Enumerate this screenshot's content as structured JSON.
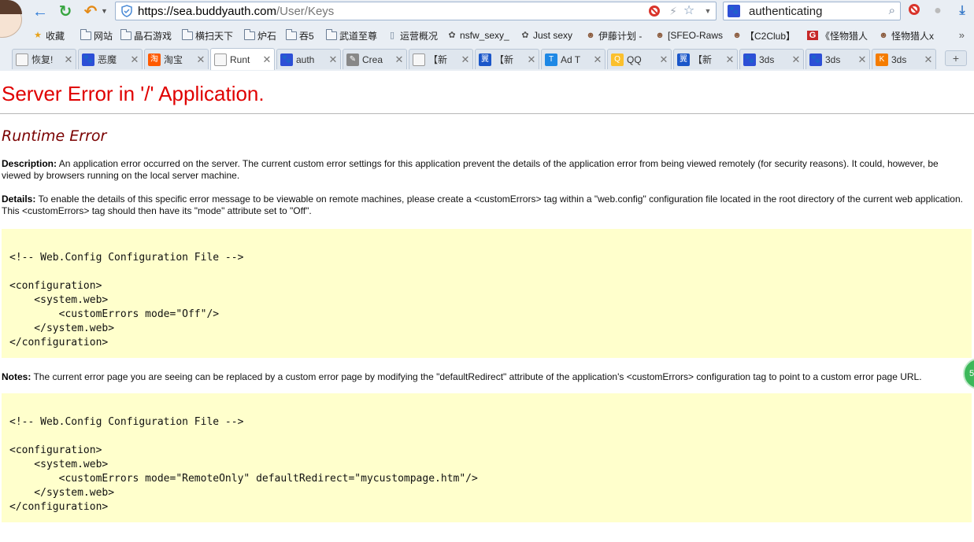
{
  "browser": {
    "url_host": "https://sea.buddyauth.com",
    "url_path": "/User/Keys",
    "search_value": "authenticating",
    "search_engine_icon": "paw-icon",
    "accent_back": "#2e7bd6",
    "accent_refresh": "#37a540"
  },
  "bookmarks": [
    {
      "label": "收藏",
      "icon": "star-icon"
    },
    {
      "label": "网站",
      "icon": "folder-icon"
    },
    {
      "label": "晶石游戏",
      "icon": "folder-icon"
    },
    {
      "label": "横扫天下",
      "icon": "folder-icon"
    },
    {
      "label": "炉石",
      "icon": "folder-icon"
    },
    {
      "label": "吞5",
      "icon": "folder-icon"
    },
    {
      "label": "武道至尊",
      "icon": "folder-icon"
    },
    {
      "label": "运营概况",
      "icon": "page-icon"
    },
    {
      "label": "nsfw_sexy_",
      "icon": "site-icon"
    },
    {
      "label": "Just sexy",
      "icon": "site-icon"
    },
    {
      "label": "伊藤计划 -",
      "icon": "anime-icon"
    },
    {
      "label": "[SFEO-Raws",
      "icon": "anime-icon"
    },
    {
      "label": "【C2Club】",
      "icon": "anime-icon"
    },
    {
      "label": "《怪物猎人",
      "icon": "g-icon"
    },
    {
      "label": "怪物猎人x",
      "icon": "anime-icon"
    }
  ],
  "bookmarks_more": "»",
  "tabs": [
    {
      "label": "恢复!",
      "icon_color": "#f0f0f0",
      "icon_text": ""
    },
    {
      "label": "恶魔",
      "icon_color": "#2d4fd6",
      "icon_text": "🐾"
    },
    {
      "label": "淘宝",
      "icon_color": "#ff5a00",
      "icon_text": "淘"
    },
    {
      "label": "Runt",
      "icon_color": "#f0f0f0",
      "icon_text": ""
    },
    {
      "label": "auth",
      "icon_color": "#2d4fd6",
      "icon_text": "🐾"
    },
    {
      "label": "Crea",
      "icon_color": "#888",
      "icon_text": "✎"
    },
    {
      "label": "【新",
      "icon_color": "#f0f0f0",
      "icon_text": ""
    },
    {
      "label": "【新",
      "icon_color": "#1a56c9",
      "icon_text": "翼"
    },
    {
      "label": "Ad T",
      "icon_color": "#1e88e5",
      "icon_text": "T"
    },
    {
      "label": "QQ",
      "icon_color": "#fbc02d",
      "icon_text": "Q"
    },
    {
      "label": "【新",
      "icon_color": "#1a56c9",
      "icon_text": "翼"
    },
    {
      "label": "3ds",
      "icon_color": "#2d4fd6",
      "icon_text": "🐾"
    },
    {
      "label": "3ds",
      "icon_color": "#2d4fd6",
      "icon_text": "🐾"
    },
    {
      "label": "3ds",
      "icon_color": "#f57c00",
      "icon_text": "K"
    }
  ],
  "page": {
    "title": "Server Error in '/' Application.",
    "subtitle": "Runtime Error",
    "description_label": "Description:",
    "description_text": " An application error occurred on the server. The current custom error settings for this application prevent the details of the application error from being viewed remotely (for security reasons). It could, however, be viewed by browsers running on the local server machine.",
    "details_label": "Details:",
    "details_text": " To enable the details of this specific error message to be viewable on remote machines, please create a <customErrors> tag within a \"web.config\" configuration file located in the root directory of the current web application. This <customErrors> tag should then have its \"mode\" attribute set to \"Off\".",
    "notes_label": "Notes:",
    "notes_text": " The current error page you are seeing can be replaced by a custom error page by modifying the \"defaultRedirect\" attribute of the application's <customErrors> configuration tag to point to a custom error page URL.",
    "code1": [
      "<!-- Web.Config Configuration File -->",
      "",
      "<configuration>",
      "    <system.web>",
      "        <customErrors mode=\"Off\"/>",
      "    </system.web>",
      "</configuration>"
    ],
    "code2": [
      "<!-- Web.Config Configuration File -->",
      "",
      "<configuration>",
      "    <system.web>",
      "        <customErrors mode=\"RemoteOnly\" defaultRedirect=\"mycustompage.htm\"/>",
      "    </system.web>",
      "</configuration>"
    ],
    "title_color": "#e00000",
    "subtitle_color": "#7a0000",
    "code_bg": "#ffffcc",
    "float_badge": "5"
  }
}
